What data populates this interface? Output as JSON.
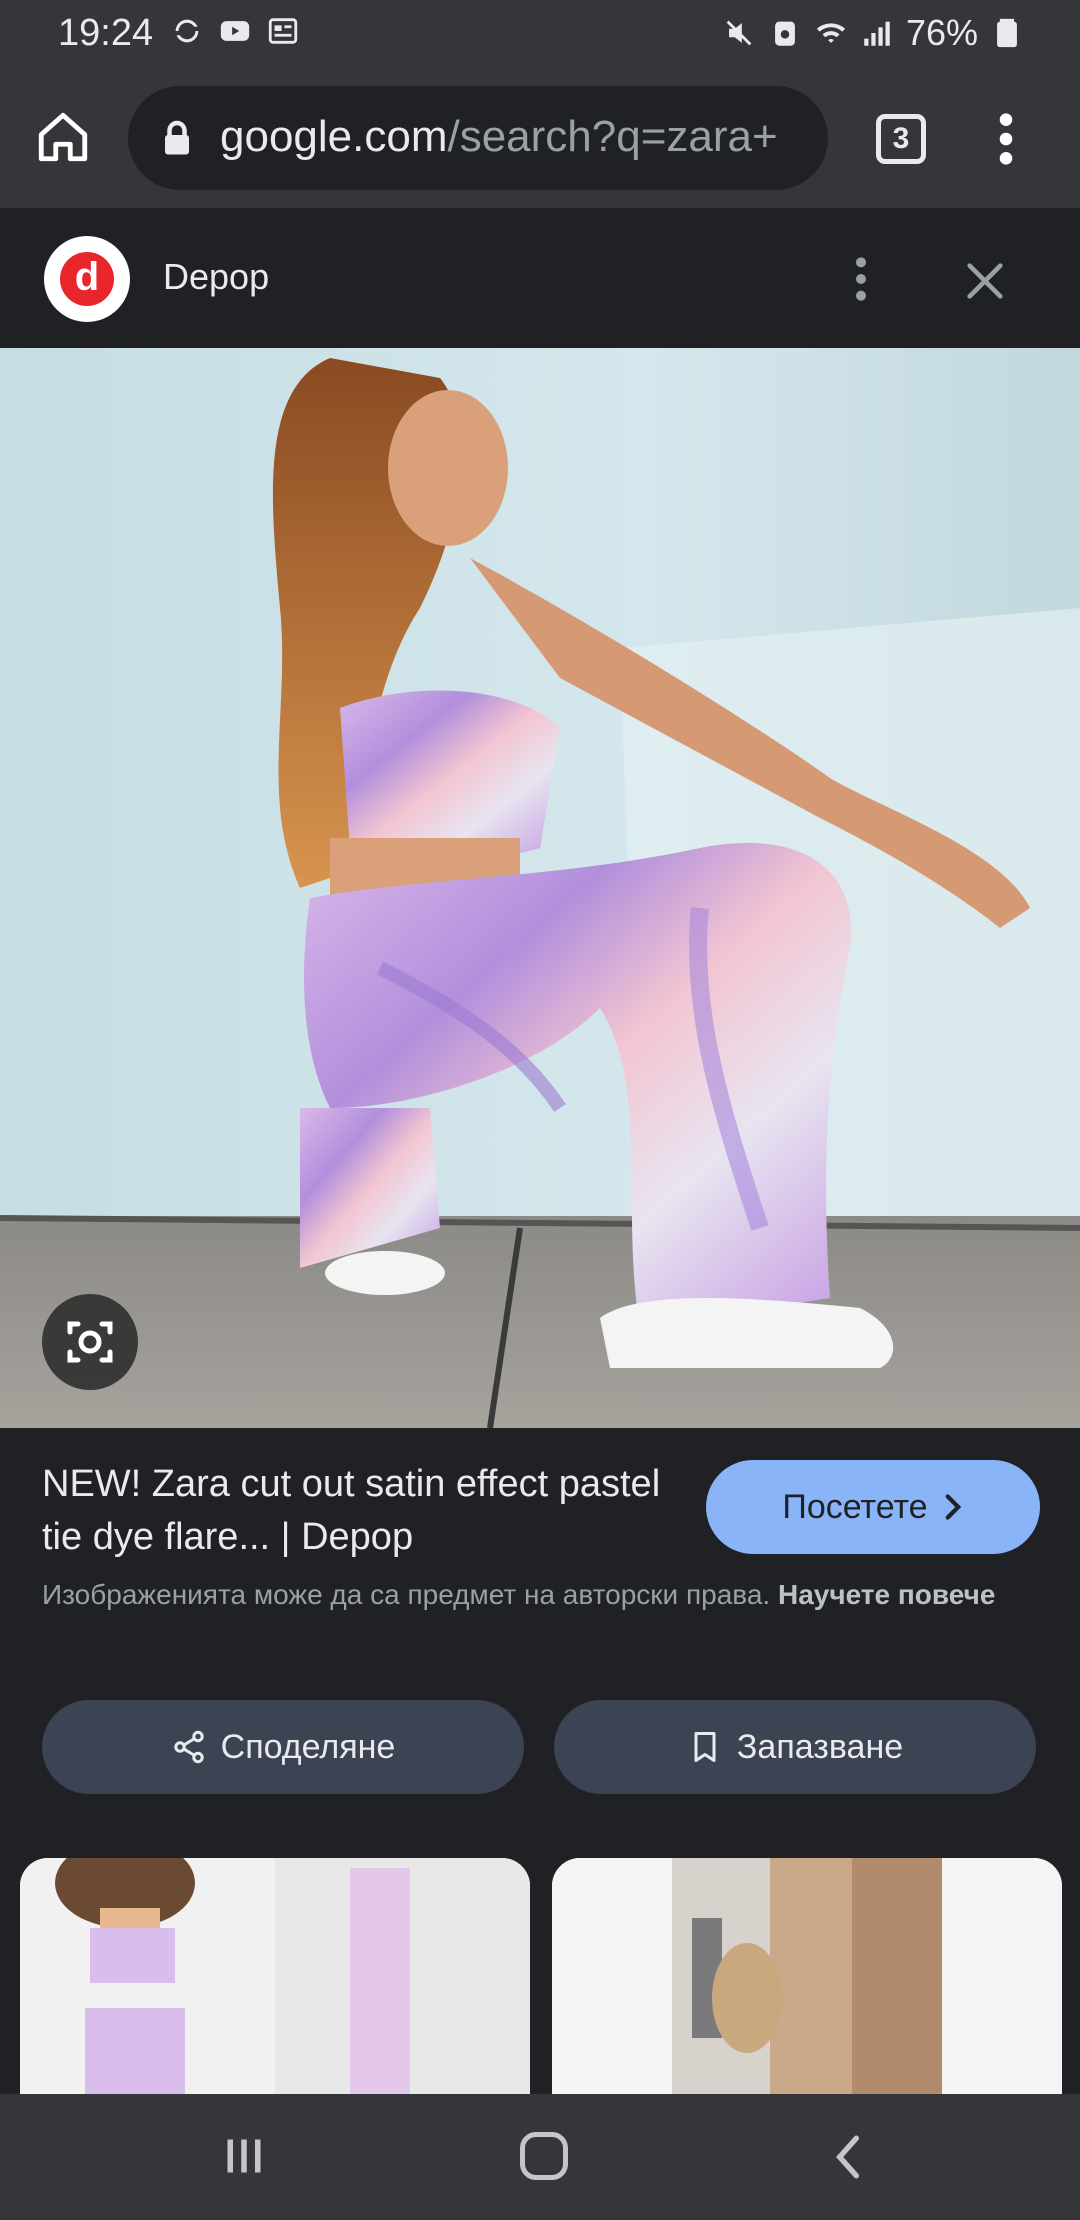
{
  "status_bar": {
    "time": "19:24",
    "battery": "76%",
    "icons_left": [
      "sync-icon",
      "youtube-icon",
      "news-icon"
    ],
    "icons_right": [
      "mute-icon",
      "recycle-icon",
      "wifi-icon",
      "signal-icon",
      "battery-icon"
    ]
  },
  "browser": {
    "url_host": "google.com",
    "url_path": "/search?q=zara+",
    "tab_count": "3"
  },
  "panel": {
    "site_name": "Depop",
    "logo_letter": "d"
  },
  "result": {
    "title": "NEW! Zara cut out satin effect pastel tie dye flare... | Depop",
    "visit_label": "Посетете",
    "copyright_text": "Изображенията може да са предмет на авторски права.",
    "learn_more": "Научете повече",
    "share_label": "Споделяне",
    "save_label": "Запазване"
  },
  "colors": {
    "accent": "#8ab4f8",
    "surface": "#202124",
    "toolbar": "#35363a",
    "action_button": "#3c4353",
    "depop_red": "#e9262b"
  }
}
